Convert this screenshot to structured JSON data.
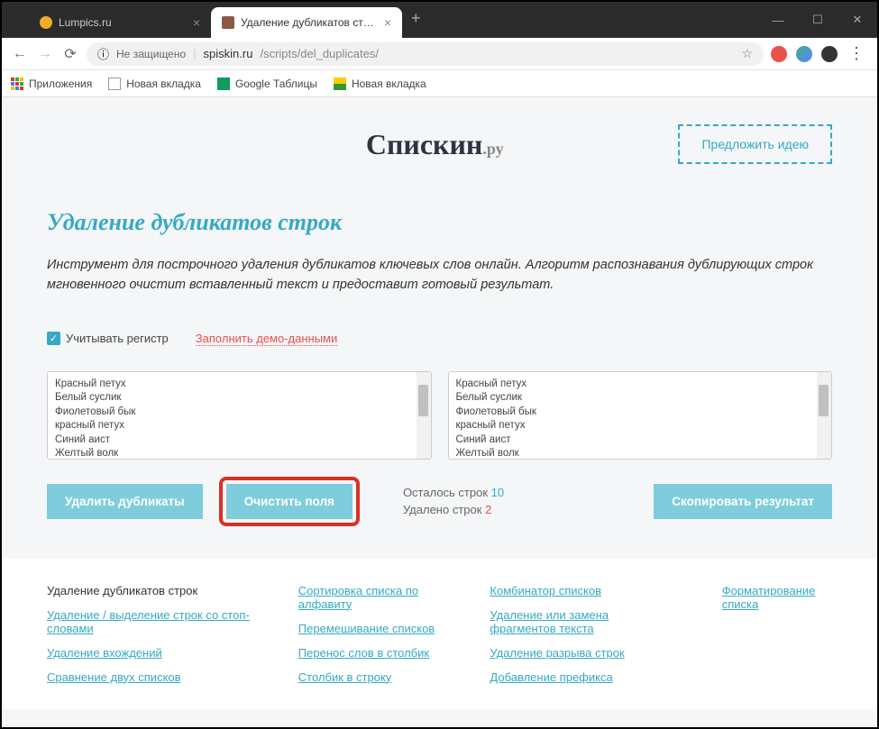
{
  "tabs": [
    {
      "title": "Lumpics.ru",
      "favicon_color": "#f0ad2b"
    },
    {
      "title": "Удаление дубликатов строк - уд",
      "favicon_color": "#8a5a44"
    }
  ],
  "window_controls": {
    "min": "—",
    "max": "☐",
    "close": "✕"
  },
  "nav": {
    "back": "←",
    "forward": "→",
    "reload": "⟳"
  },
  "url": {
    "security_icon": "ⓘ",
    "security_text": "Не защищено",
    "domain": "spiskin.ru",
    "path": "/scripts/del_duplicates/"
  },
  "bookmarks": [
    {
      "label": "Приложения",
      "icon_svg": "apps"
    },
    {
      "label": "Новая вкладка",
      "icon_svg": "doc"
    },
    {
      "label": "Google Таблицы",
      "icon_svg": "sheets"
    },
    {
      "label": "Новая вкладка",
      "icon_svg": "img"
    }
  ],
  "logo": {
    "main": "Спискин",
    "suffix": ".ру"
  },
  "suggest_button": "Предложить идею",
  "page_title": "Удаление дубликатов строк",
  "description": "Инструмент для построчного удаления дубликатов ключевых слов онлайн. Алгоритм распознавания дублирующих строк мгновенного очистит вставленный текст и предоставит готовый результат.",
  "options": {
    "case_sensitive": "Учитывать регистр",
    "demo_data": "Заполнить демо-данными"
  },
  "input_text": "Красный петух\nБелый суслик\nФиолетовый бык\nкрасный петух\nСиний аист\nЖелтый волк\nОранжевый медведь\nСиний аист",
  "output_text": "Красный петух\nБелый суслик\nФиолетовый бык\nкрасный петух\nСиний аист\nЖелтый волк\nОранжевый медведь\nЧерный страус",
  "buttons": {
    "remove_duplicates": "Удалить дубликаты",
    "clear_fields": "Очистить поля",
    "copy_result": "Скопировать результат"
  },
  "stats": {
    "remaining_label": "Осталось строк",
    "remaining_value": "10",
    "removed_label": "Удалено строк",
    "removed_value": "2"
  },
  "footer": {
    "col1": [
      {
        "text": "Удаление дубликатов строк",
        "head": true
      },
      {
        "text": "Удаление / выделение строк со стоп-словами"
      },
      {
        "text": "Удаление вхождений"
      },
      {
        "text": "Сравнение двух списков"
      }
    ],
    "col2": [
      {
        "text": "Сортировка списка по алфавиту"
      },
      {
        "text": "Перемешивание списков"
      },
      {
        "text": "Перенос слов в столбик"
      },
      {
        "text": "Столбик в строку"
      }
    ],
    "col3": [
      {
        "text": "Комбинатор списков"
      },
      {
        "text": "Удаление или замена фрагментов текста"
      },
      {
        "text": "Удаление разрыва строк"
      },
      {
        "text": "Добавление префикса"
      }
    ],
    "col4": [
      {
        "text": "Форматирование списка"
      }
    ]
  }
}
